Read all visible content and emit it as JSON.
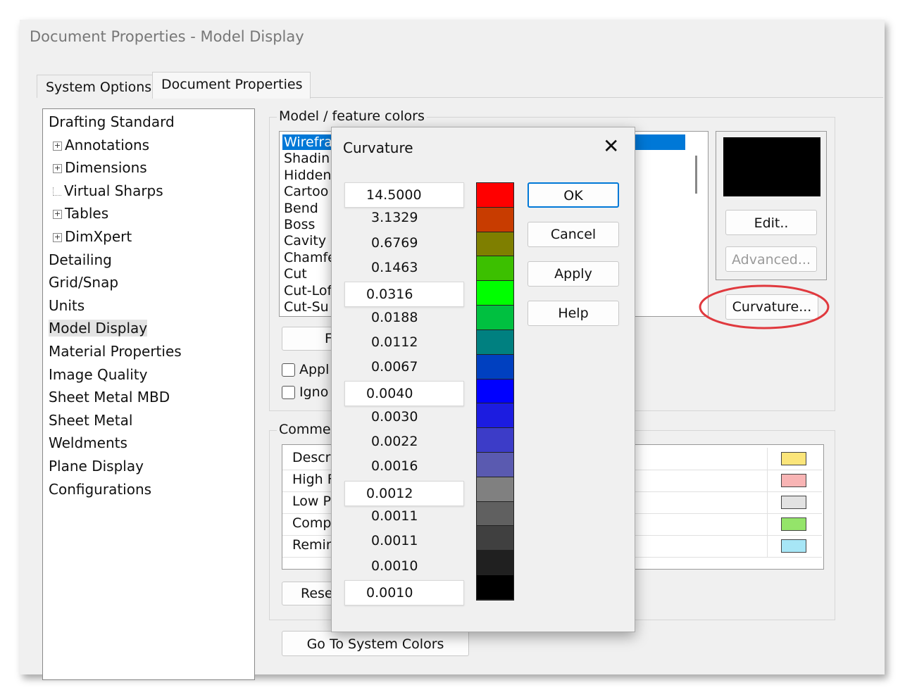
{
  "window": {
    "title": "Document Properties - Model Display"
  },
  "tabs": [
    "System Options",
    "Document Properties"
  ],
  "tree": [
    {
      "label": "Drafting Standard",
      "expand": false,
      "indent": 0
    },
    {
      "label": "Annotations",
      "expand": true,
      "indent": 1
    },
    {
      "label": "Dimensions",
      "expand": true,
      "indent": 1
    },
    {
      "label": "Virtual Sharps",
      "expand": false,
      "indent": 1
    },
    {
      "label": "Tables",
      "expand": true,
      "indent": 1
    },
    {
      "label": "DimXpert",
      "expand": true,
      "indent": 1
    },
    {
      "label": "Detailing",
      "expand": false,
      "indent": 0
    },
    {
      "label": "Grid/Snap",
      "expand": false,
      "indent": 0
    },
    {
      "label": "Units",
      "expand": false,
      "indent": 0
    },
    {
      "label": "Model Display",
      "expand": false,
      "indent": 0,
      "selected": true
    },
    {
      "label": "Material Properties",
      "expand": false,
      "indent": 0
    },
    {
      "label": "Image Quality",
      "expand": false,
      "indent": 0
    },
    {
      "label": "Sheet Metal MBD",
      "expand": false,
      "indent": 0
    },
    {
      "label": "Sheet Metal",
      "expand": false,
      "indent": 0
    },
    {
      "label": "Weldments",
      "expand": false,
      "indent": 0
    },
    {
      "label": "Plane Display",
      "expand": false,
      "indent": 0
    },
    {
      "label": "Configurations",
      "expand": false,
      "indent": 0
    }
  ],
  "model_colors": {
    "group_label": "Model / feature colors",
    "items": [
      "Wirefra",
      "Shadin",
      "Hidden",
      "Cartoo",
      "Bend",
      "Boss",
      "Cavity",
      "Chamfe",
      "Cut",
      "Cut-Lof",
      "Cut-Su"
    ],
    "edit_button": "Edit..",
    "advanced_button": "Advanced...",
    "curvature_button": "Curvature...",
    "partial_button": "F",
    "check1": "Appl",
    "check2": "Igno",
    "preview_color": "#000000"
  },
  "comment_colors": {
    "group_label": "Commer",
    "rows": [
      {
        "label": "Descri",
        "color": "#fbe57a"
      },
      {
        "label": "High F",
        "color": "#f8b4b4"
      },
      {
        "label": "Low P",
        "color": "#e2e2e2"
      },
      {
        "label": "Comp",
        "color": "#94e46a"
      },
      {
        "label": "Remin",
        "color": "#a7e6f6"
      }
    ],
    "reset_button": "Rese"
  },
  "system_colors_button": "Go To System Colors",
  "curvature_dialog": {
    "title": "Curvature",
    "close_glyph": "✕",
    "values": [
      {
        "v": "14.5000",
        "box": true
      },
      {
        "v": "3.1329",
        "box": false
      },
      {
        "v": "0.6769",
        "box": false
      },
      {
        "v": "0.1463",
        "box": false
      },
      {
        "v": "0.0316",
        "box": true
      },
      {
        "v": "0.0188",
        "box": false
      },
      {
        "v": "0.0112",
        "box": false
      },
      {
        "v": "0.0067",
        "box": false
      },
      {
        "v": "0.0040",
        "box": true
      },
      {
        "v": "0.0030",
        "box": false
      },
      {
        "v": "0.0022",
        "box": false
      },
      {
        "v": "0.0016",
        "box": false
      },
      {
        "v": "0.0012",
        "box": true
      },
      {
        "v": "0.0011",
        "box": false
      },
      {
        "v": "0.0011",
        "box": false
      },
      {
        "v": "0.0010",
        "box": false
      },
      {
        "v": "0.0010",
        "box": true
      }
    ],
    "color_scale": [
      "#ff0000",
      "#c83c00",
      "#7f7f00",
      "#3cc000",
      "#00ff00",
      "#00c040",
      "#008080",
      "#0040c0",
      "#0000ff",
      "#1c1ce0",
      "#3c3cc8",
      "#5a5ab0",
      "#808080",
      "#606060",
      "#404040",
      "#202020",
      "#000000"
    ],
    "buttons": [
      "OK",
      "Cancel",
      "Apply",
      "Help"
    ]
  },
  "highlight_color": "#e0393e"
}
